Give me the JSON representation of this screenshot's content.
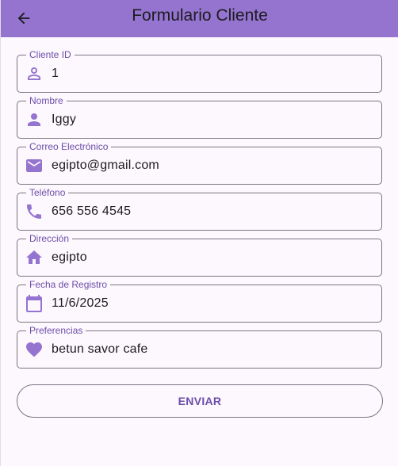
{
  "app_bar": {
    "title": "Formulario Cliente",
    "back_icon": "arrow-back-icon",
    "background_color": "#9474cf"
  },
  "form": {
    "fields": [
      {
        "label": "Cliente ID",
        "value": "1",
        "icon": "person-outline-icon"
      },
      {
        "label": "Nombre",
        "value": "Iggy",
        "icon": "person-icon"
      },
      {
        "label": "Correo Electrónico",
        "value": "egipto@gmail.com",
        "icon": "email-icon"
      },
      {
        "label": "Teléfono",
        "value": "656 556 4545",
        "icon": "phone-icon"
      },
      {
        "label": "Dirección",
        "value": "egipto",
        "icon": "home-icon"
      },
      {
        "label": "Fecha de Registro",
        "value": "11/6/2025",
        "icon": "calendar-icon"
      },
      {
        "label": "Preferencias",
        "value": "betun savor cafe",
        "icon": "heart-icon"
      }
    ],
    "submit_label": "ENVIAR"
  },
  "colors": {
    "accent": "#6a4fa8",
    "icon": "#9474cf",
    "border": "#7a7580",
    "background": "#fdf7fe"
  }
}
